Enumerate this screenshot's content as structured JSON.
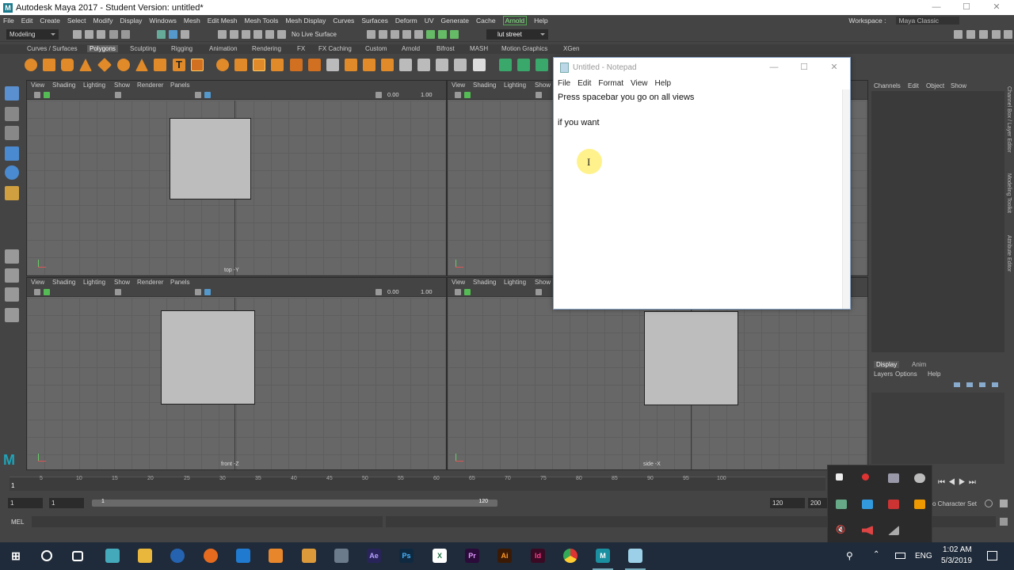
{
  "window": {
    "title": "Autodesk Maya 2017 - Student Version: untitled*",
    "minimize": "—",
    "maximize": "☐",
    "close": "✕"
  },
  "menubar": {
    "items": [
      "File",
      "Edit",
      "Create",
      "Select",
      "Modify",
      "Display",
      "Windows",
      "Mesh",
      "Edit Mesh",
      "Mesh Tools",
      "Mesh Display",
      "Curves",
      "Surfaces",
      "Deform",
      "UV",
      "Generate",
      "Cache"
    ],
    "arnold": "Arnold",
    "help": "Help",
    "workspace_label": "Workspace :",
    "workspace_value": "Maya Classic"
  },
  "statusline": {
    "menu_set": "Modeling",
    "live_surface": "No Live Surface",
    "user": "lut street"
  },
  "shelf_tabs": [
    "Curves / Surfaces",
    "Polygons",
    "Sculpting",
    "Rigging",
    "Animation",
    "Rendering",
    "FX",
    "FX Caching",
    "Custom",
    "Arnold",
    "Bifrost",
    "MASH",
    "Motion Graphics",
    "XGen"
  ],
  "shelf_active": "Polygons",
  "viewport_menu": [
    "View",
    "Shading",
    "Lighting",
    "Show",
    "Renderer",
    "Panels"
  ],
  "viewport_values": {
    "field1": "0.00",
    "field2": "1.00"
  },
  "viewports": {
    "top": {
      "label": "top -Y"
    },
    "persp": {
      "label": ""
    },
    "front": {
      "label": "front -Z"
    },
    "side": {
      "label": "side -X"
    }
  },
  "channel_box": {
    "menu": [
      "Channels",
      "Edit",
      "Object",
      "Show"
    ],
    "side_tabs": [
      "Channel Box / Layer Editor",
      "Modeling Toolkit",
      "Attribute Editor"
    ]
  },
  "layer_editor": {
    "tabs": [
      "Display",
      "Anim"
    ],
    "menu": [
      "Layers",
      "Options",
      "Help"
    ]
  },
  "timeline": {
    "ticks": [
      "5",
      "10",
      "15",
      "20",
      "25",
      "30",
      "35",
      "40",
      "45",
      "50",
      "55",
      "60",
      "65",
      "70",
      "75",
      "80",
      "85",
      "90",
      "95",
      "100"
    ],
    "current": "1"
  },
  "range": {
    "start": "1",
    "inner_start": "1",
    "slider_start": "1",
    "slider_end": "120",
    "end": "120",
    "outer_end": "200",
    "character_set": "o Character Set"
  },
  "commandline": {
    "label": "MEL"
  },
  "notepad": {
    "title": "Untitled - Notepad",
    "menu": [
      "File",
      "Edit",
      "Format",
      "View",
      "Help"
    ],
    "lines": [
      "Press spacebar you go on all views",
      "",
      "if you want"
    ]
  },
  "taskbar": {
    "apps": [
      "Start",
      "Cortana",
      "Task View",
      "Maya Launcher",
      "File Explorer",
      "Blender",
      "Firefox",
      "Outlook",
      "Blender Orange",
      "Sublime",
      "Files",
      "After Effects",
      "Photoshop",
      "Excel",
      "Premiere",
      "Illustrator",
      "InDesign",
      "Chrome",
      "Maya",
      "Notepad"
    ],
    "lang": "ENG",
    "time": "1:02 AM",
    "date": "5/3/2019"
  }
}
